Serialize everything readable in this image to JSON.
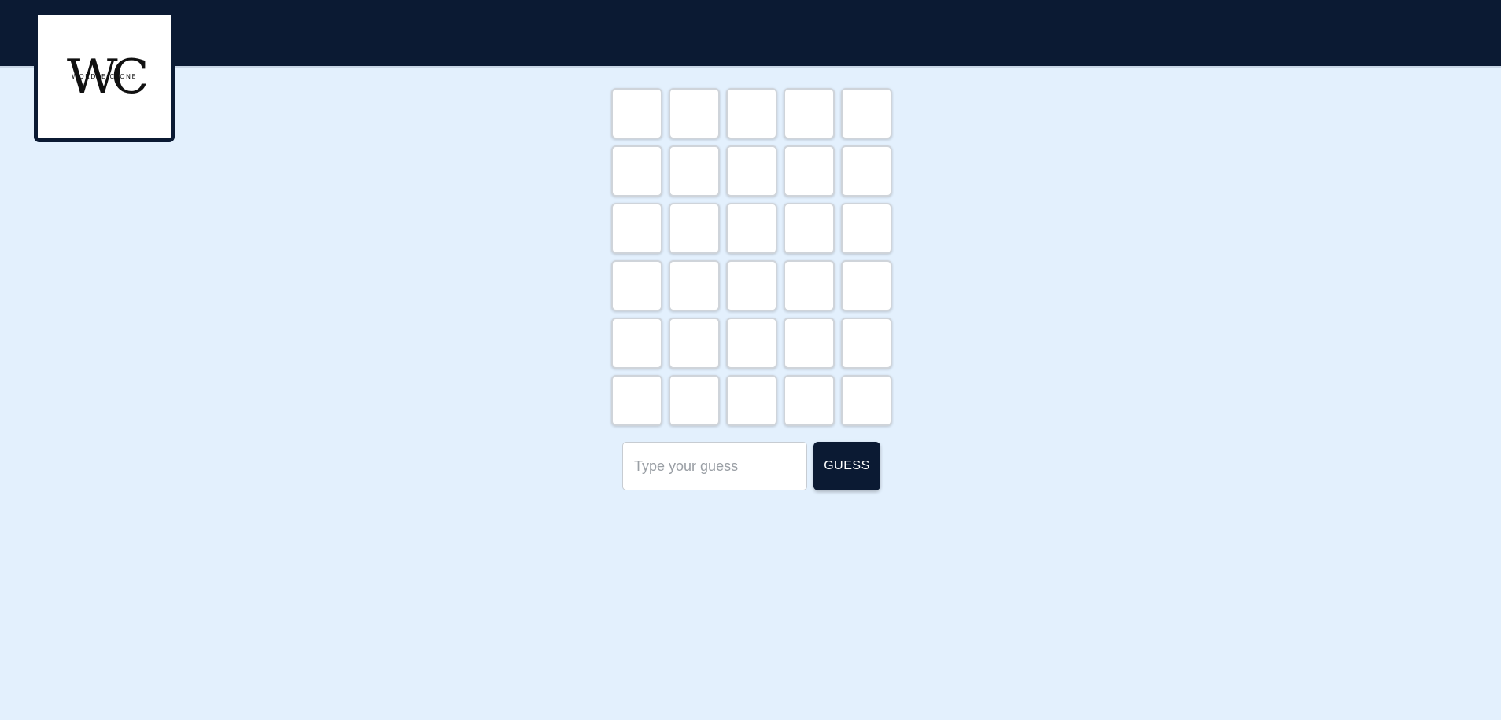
{
  "colors": {
    "background": "#e3f0fd",
    "header": "#0b1a33",
    "tile_fill": "#ffffff",
    "tile_border": "#cfd4da",
    "button": "#0b1a33",
    "button_text": "#ffffff"
  },
  "logo": {
    "letters": "WC",
    "caption": "WORDLE CLONE"
  },
  "board": {
    "rows": 6,
    "cols": 5,
    "tiles": [
      [
        "",
        "",
        "",
        "",
        ""
      ],
      [
        "",
        "",
        "",
        "",
        ""
      ],
      [
        "",
        "",
        "",
        "",
        ""
      ],
      [
        "",
        "",
        "",
        "",
        ""
      ],
      [
        "",
        "",
        "",
        "",
        ""
      ],
      [
        "",
        "",
        "",
        "",
        ""
      ]
    ]
  },
  "guess": {
    "value": "",
    "placeholder": "Type your guess",
    "button_label": "GUESS"
  }
}
